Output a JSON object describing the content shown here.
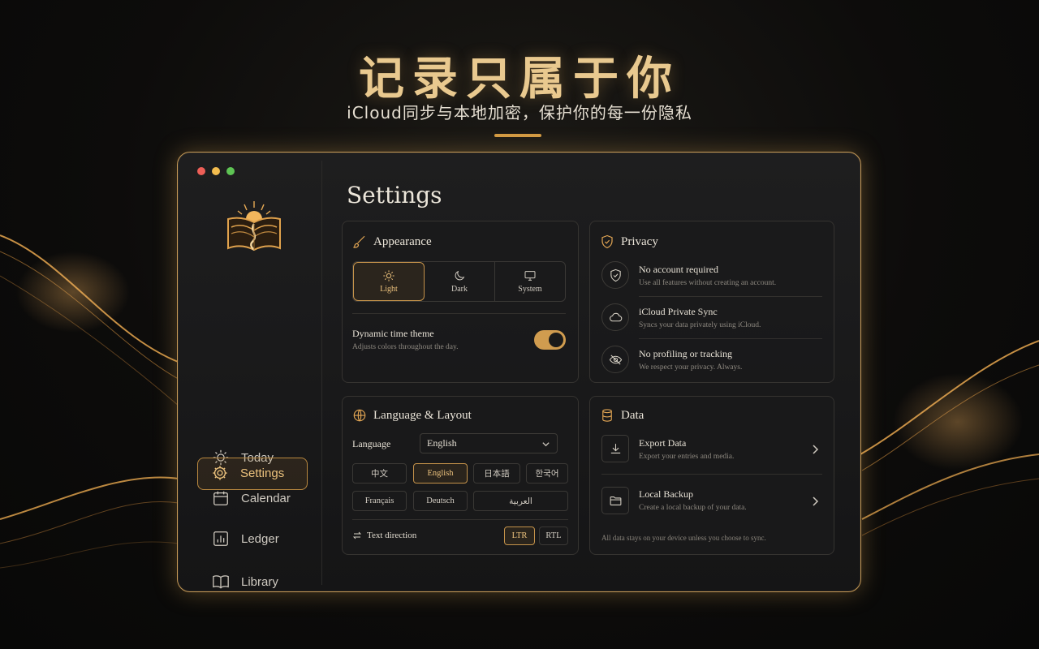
{
  "hero": {
    "title": "记录只属于你",
    "subtitle": "iCloud同步与本地加密，保护你的每一份隐私"
  },
  "colors": {
    "accent": "#d39a43",
    "accent_light": "#ecc27d",
    "panel": "#1a1a1b"
  },
  "sidebar": {
    "logo": "book-sunrise-logo",
    "items": [
      {
        "label": "Today",
        "icon": "sun-icon"
      },
      {
        "label": "Calendar",
        "icon": "calendar-icon"
      },
      {
        "label": "Ledger",
        "icon": "chart-icon"
      },
      {
        "label": "Library",
        "icon": "book-icon"
      },
      {
        "label": "Settings",
        "icon": "gear-icon",
        "active": true
      }
    ]
  },
  "page": {
    "title": "Settings"
  },
  "appearance": {
    "title": "Appearance",
    "modes": [
      {
        "label": "Light",
        "icon": "sun-icon",
        "selected": true
      },
      {
        "label": "Dark",
        "icon": "moon-icon"
      },
      {
        "label": "System",
        "icon": "monitor-icon"
      }
    ],
    "dynamic_title": "Dynamic time theme",
    "dynamic_sub": "Adjusts colors throughout the day.",
    "dynamic_enabled": true
  },
  "privacy": {
    "title": "Privacy",
    "items": [
      {
        "title": "No account required",
        "sub": "Use all features without creating an account.",
        "icon": "shield-check-icon"
      },
      {
        "title": "iCloud Private Sync",
        "sub": "Syncs your data privately using iCloud.",
        "icon": "cloud-icon"
      },
      {
        "title": "No profiling or tracking",
        "sub": "We respect your privacy. Always.",
        "icon": "eye-off-icon"
      }
    ]
  },
  "language": {
    "title": "Language & Layout",
    "label": "Language",
    "selected": "English",
    "options": [
      "中文",
      "English",
      "日本語",
      "한국어",
      "Français",
      "Deutsch",
      "العربية"
    ],
    "text_direction_label": "Text direction",
    "directions": [
      "LTR",
      "RTL"
    ],
    "direction_selected": "LTR"
  },
  "data": {
    "title": "Data",
    "items": [
      {
        "title": "Export Data",
        "sub": "Export your entries and media.",
        "icon": "download-icon"
      },
      {
        "title": "Local Backup",
        "sub": "Create a local backup of your data.",
        "icon": "folder-icon"
      }
    ],
    "footer": "All data stays on your device unless you choose to sync."
  }
}
